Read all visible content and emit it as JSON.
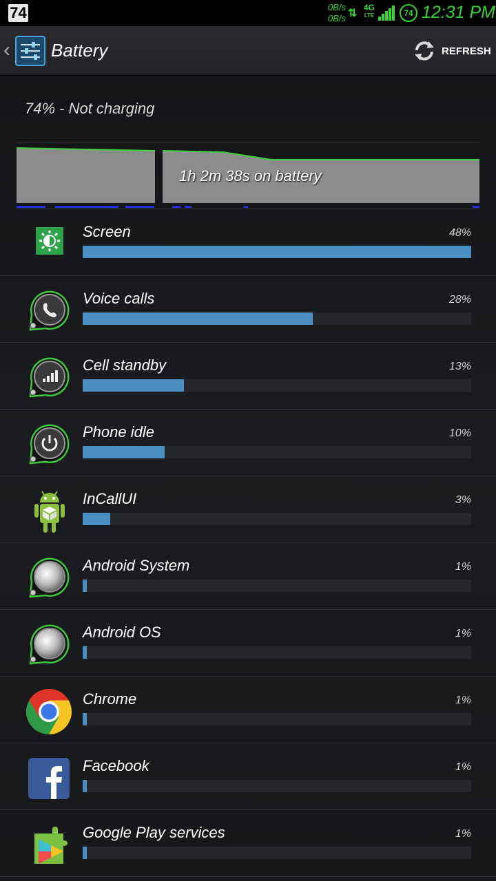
{
  "status_bar": {
    "notification": "74",
    "speed_up": "0B/s",
    "speed_down": "0B/s",
    "network": "4G",
    "network_sub": "LTE",
    "battery_level": "74",
    "time": "12:31 PM",
    "accent": "#33d62f"
  },
  "action_bar": {
    "title": "Battery",
    "refresh_label": "REFRESH"
  },
  "summary": {
    "status": "74% - Not charging",
    "duration": "1h 2m 38s on battery"
  },
  "usage_items": [
    {
      "name": "Screen",
      "percent": "48%",
      "fill": 1.0,
      "icon": "brightness-icon"
    },
    {
      "name": "Voice calls",
      "percent": "28%",
      "fill": 0.593,
      "icon": "phone-call-icon"
    },
    {
      "name": "Cell standby",
      "percent": "13%",
      "fill": 0.261,
      "icon": "signal-bars-icon"
    },
    {
      "name": "Phone idle",
      "percent": "10%",
      "fill": 0.211,
      "icon": "power-icon"
    },
    {
      "name": "InCallUI",
      "percent": "3%",
      "fill": 0.071,
      "icon": "android-robot-icon"
    },
    {
      "name": "Android System",
      "percent": "1%",
      "fill": 0.011,
      "icon": "metal-disc-icon"
    },
    {
      "name": "Android OS",
      "percent": "1%",
      "fill": 0.011,
      "icon": "metal-disc-icon"
    },
    {
      "name": "Chrome",
      "percent": "1%",
      "fill": 0.011,
      "icon": "chrome-icon"
    },
    {
      "name": "Facebook",
      "percent": "1%",
      "fill": 0.011,
      "icon": "facebook-icon"
    },
    {
      "name": "Google Play services",
      "percent": "1%",
      "fill": 0.011,
      "icon": "play-services-icon"
    }
  ]
}
